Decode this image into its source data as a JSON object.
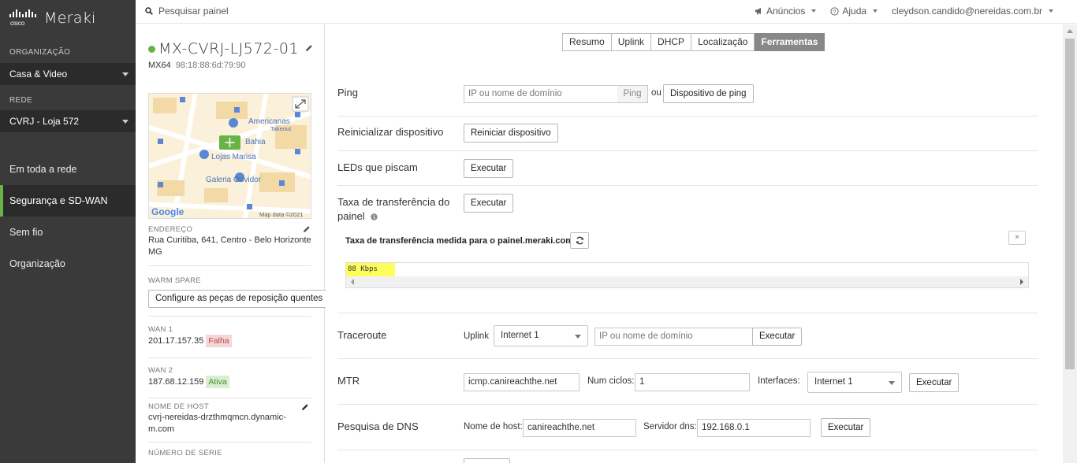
{
  "nav": {
    "logo_mark": "cisco",
    "brand": "Meraki",
    "org_section": "ORGANIZAÇÃO",
    "org_value": "Casa & Video",
    "net_section": "REDE",
    "net_value": "CVRJ - Loja 572",
    "items": [
      "Em toda a rede",
      "Segurança e SD-WAN",
      "Sem fio",
      "Organização"
    ],
    "active_item": "Segurança e SD-WAN",
    "accent_color": "#67b346"
  },
  "topbar": {
    "search_placeholder": "Pesquisar painel",
    "announcements": "Anúncios",
    "help": "Ajuda",
    "user": "cleydson.candido@nereidas.com.br"
  },
  "device": {
    "name": "MX-CVRJ-LJ572-01",
    "status": "online",
    "model": "MX64",
    "mac": "98:18:88:6d:79:90",
    "map": {
      "labels": [
        "Americanas",
        "Takeout",
        "Bahia",
        "Lojas Marisa",
        "Galeria Ouvidor"
      ],
      "google": "Google",
      "map_data": "Map data ©2021"
    },
    "address_label": "ENDEREÇO",
    "address_line1": "Rua Curitiba, 641, Centro - Belo Horizonte",
    "address_line2": "MG",
    "warm_spare_label": "WARM SPARE",
    "warm_spare_button": "Configure as peças de reposição quentes",
    "wan1_label": "WAN 1",
    "wan1_ip": "201.17.157.35",
    "wan1_status": "Falha",
    "wan2_label": "WAN 2",
    "wan2_ip": "187.68.12.159",
    "wan2_status": "Ativa",
    "hostname_label": "NOME DE HOST",
    "hostname_line1": "cvrj-nereidas-drzthmqmcn.dynamic-",
    "hostname_line2": "m.com",
    "serial_label": "NÚMERO DE SÉRIE"
  },
  "tabs": [
    "Resumo",
    "Uplink",
    "DHCP",
    "Localização",
    "Ferramentas"
  ],
  "active_tab": "Ferramentas",
  "tools": {
    "ping": {
      "label": "Ping",
      "placeholder": "IP ou nome de domínio",
      "addon": "Ping",
      "or": "ou",
      "button": "Dispositivo de ping"
    },
    "reboot": {
      "label": "Reinicializar dispositivo",
      "button": "Reiniciar dispositivo"
    },
    "leds": {
      "label": "LEDs que piscam",
      "button": "Executar"
    },
    "throughput": {
      "label_line1": "Taxa de transferência do",
      "label_line2": "painel",
      "button": "Executar",
      "result_title": "Taxa de transferência medida para o painel.meraki.com",
      "result_value": "88 Kbps",
      "close": "×"
    },
    "traceroute": {
      "label": "Traceroute",
      "uplink_label": "Uplink",
      "uplink_value": "Internet 1",
      "placeholder": "IP ou nome de domínio",
      "button": "Executar"
    },
    "mtr": {
      "label": "MTR",
      "host_value": "icmp.canireachthe.net",
      "cycles_label": "Num ciclos:",
      "cycles_value": "1",
      "interfaces_label": "Interfaces:",
      "interfaces_value": "Internet 1",
      "button": "Executar"
    },
    "dns": {
      "label": "Pesquisa de DNS",
      "host_label": "Nome de host:",
      "host_value": "canireachthe.net",
      "server_label": "Servidor dns:",
      "server_value": "192.168.0.1",
      "button": "Executar"
    }
  }
}
